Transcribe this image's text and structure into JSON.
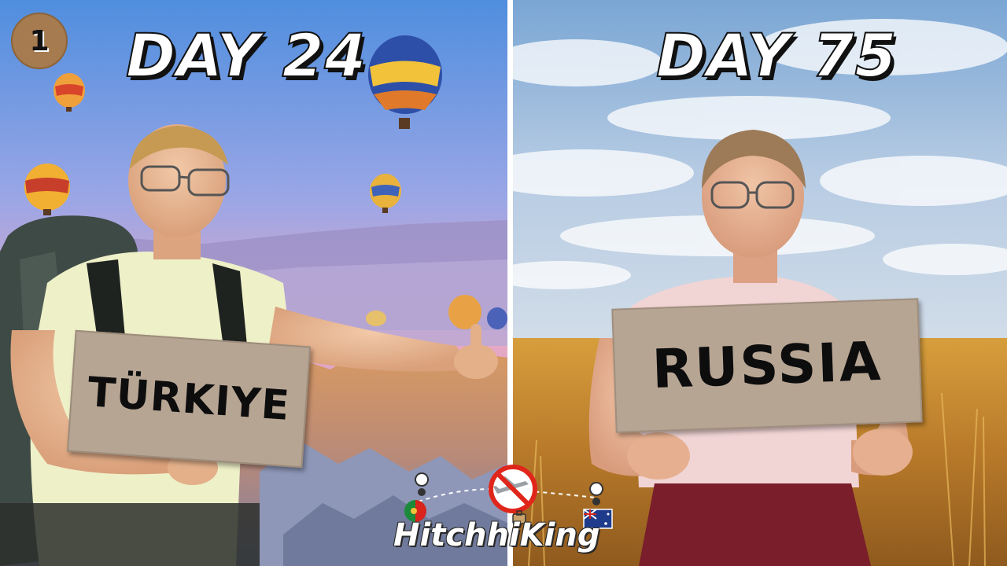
{
  "left_panel": {
    "badge_number": "1",
    "title": "DAY 24",
    "sign_text": "TÜRKIYE"
  },
  "right_panel": {
    "title": "DAY 75",
    "sign_text": "RUSSIA"
  },
  "logo": {
    "text": "HitchhiKing",
    "icons": [
      "portugal-flag-pin-icon",
      "no-plane-icon",
      "australia-flag-pin-icon",
      "luggage-icon"
    ]
  },
  "colors": {
    "badge": "#a57b4f",
    "sign": "#b7a594",
    "no_sign_red": "#e0261b"
  }
}
